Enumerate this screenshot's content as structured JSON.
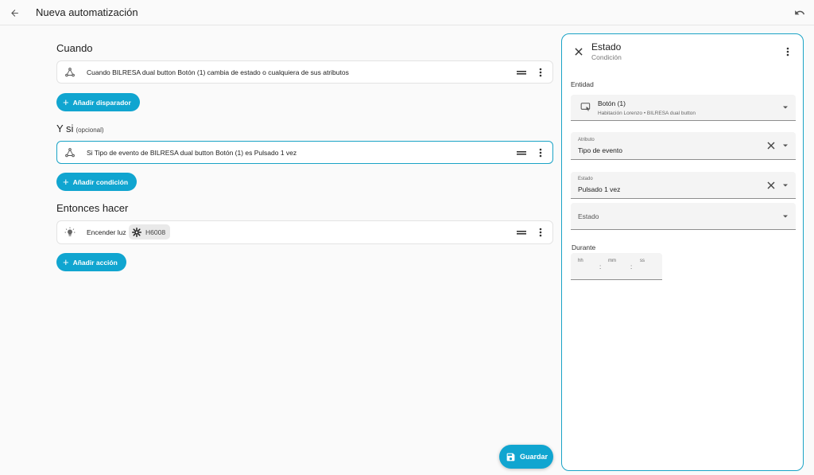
{
  "header": {
    "title": "Nueva automatización",
    "back_icon": "arrow-left-icon",
    "undo_icon": "undo-icon"
  },
  "sections": {
    "when": {
      "title": "Cuando",
      "trigger_text": "Cuando BILRESA dual button Botón (1) cambia de estado o cualquiera de sus atributos",
      "add_label": "Añadir disparador"
    },
    "and_if": {
      "title": "Y si",
      "subtitle": "(opcional)",
      "condition_text": "Si Tipo de evento de BILRESA dual button Botón (1) es Pulsado 1 vez",
      "add_label": "Añadir condición"
    },
    "then_do": {
      "title": "Entonces hacer",
      "action_text": "Encender luz",
      "action_chip": "H6008",
      "add_label": "Añadir acción"
    }
  },
  "save_label": "Guardar",
  "panel": {
    "title": "Estado",
    "subtitle": "Condición",
    "entity_label": "Entidad",
    "entity_name": "Botón (1)",
    "entity_area": "Habitación Lorenzo",
    "entity_separator": "•",
    "entity_device": "BILRESA dual button",
    "attribute_label": "Atributo",
    "attribute_value": "Tipo de evento",
    "state_label": "Estado",
    "state_value": "Pulsado 1 vez",
    "state_placeholder": "Estado",
    "duration_label": "Durante",
    "duration_hh": "hh",
    "duration_mm": "mm",
    "duration_ss": "ss",
    "duration_sep": ":"
  },
  "colors": {
    "accent": "#10a5d0",
    "panel_border": "#1aa3c6",
    "background": "#fafafa"
  }
}
